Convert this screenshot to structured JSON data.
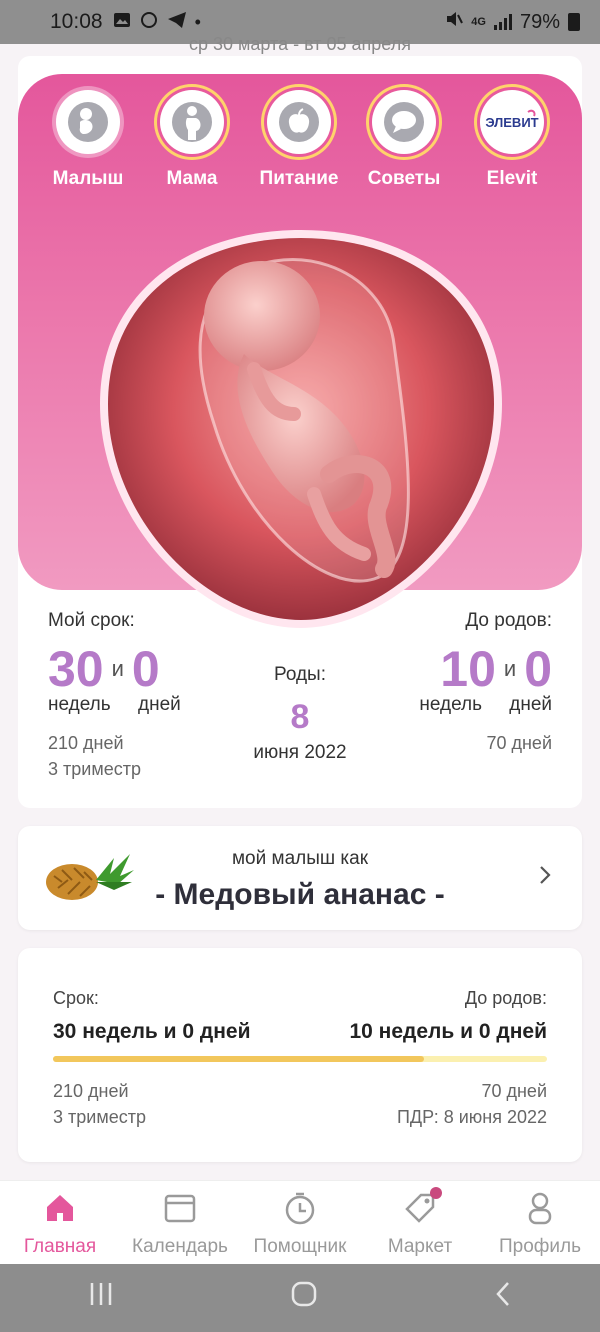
{
  "status_bar": {
    "time": "10:08",
    "network": "4G",
    "battery": "79%"
  },
  "date_range": "ср 30 марта - вт 05 апреля",
  "sections": [
    {
      "label": "Малыш",
      "icon": "baby-icon"
    },
    {
      "label": "Мама",
      "icon": "mom-icon"
    },
    {
      "label": "Питание",
      "icon": "apple-icon"
    },
    {
      "label": "Советы",
      "icon": "chat-bubble-icon"
    },
    {
      "label": "Elevit",
      "icon": "elevit-logo",
      "logo_text": "ЭЛЕВИТ"
    }
  ],
  "term": {
    "label": "Мой срок:",
    "weeks": "30",
    "and": "и",
    "days": "0",
    "weeks_unit": "недель",
    "days_unit": "дней",
    "total_days": "210 дней",
    "trimester": "3 триместр"
  },
  "birth": {
    "label": "Роды:",
    "day": "8",
    "month_year": "июня 2022"
  },
  "remaining": {
    "label": "До родов:",
    "weeks": "10",
    "and": "и",
    "days": "0",
    "weeks_unit": "недель",
    "days_unit": "дней",
    "total_days": "70 дней"
  },
  "baby_size": {
    "caption": "мой малыш как",
    "fruit": "- Медовый ананас -"
  },
  "progress": {
    "term_label": "Срок:",
    "term_value": "30 недель и 0 дней",
    "remaining_label": "До родов:",
    "remaining_value": "10 недель и 0 дней",
    "fraction": 0.75,
    "days": "210 дней",
    "trimester": "3 триместр",
    "remaining_days": "70 дней",
    "due_date": "ПДР: 8 июня 2022"
  },
  "tabs": [
    {
      "label": "Главная",
      "icon": "home-icon",
      "active": true
    },
    {
      "label": "Календарь",
      "icon": "calendar-icon",
      "active": false
    },
    {
      "label": "Помощник",
      "icon": "timer-icon",
      "active": false
    },
    {
      "label": "Маркет",
      "icon": "tag-icon",
      "active": false
    },
    {
      "label": "Профиль",
      "icon": "profile-icon",
      "active": false
    }
  ],
  "colors": {
    "accent": "#e4579c",
    "numbers": "#b57ac8",
    "progress_fill": "#f2c75c",
    "progress_track": "#fbf0b0"
  }
}
